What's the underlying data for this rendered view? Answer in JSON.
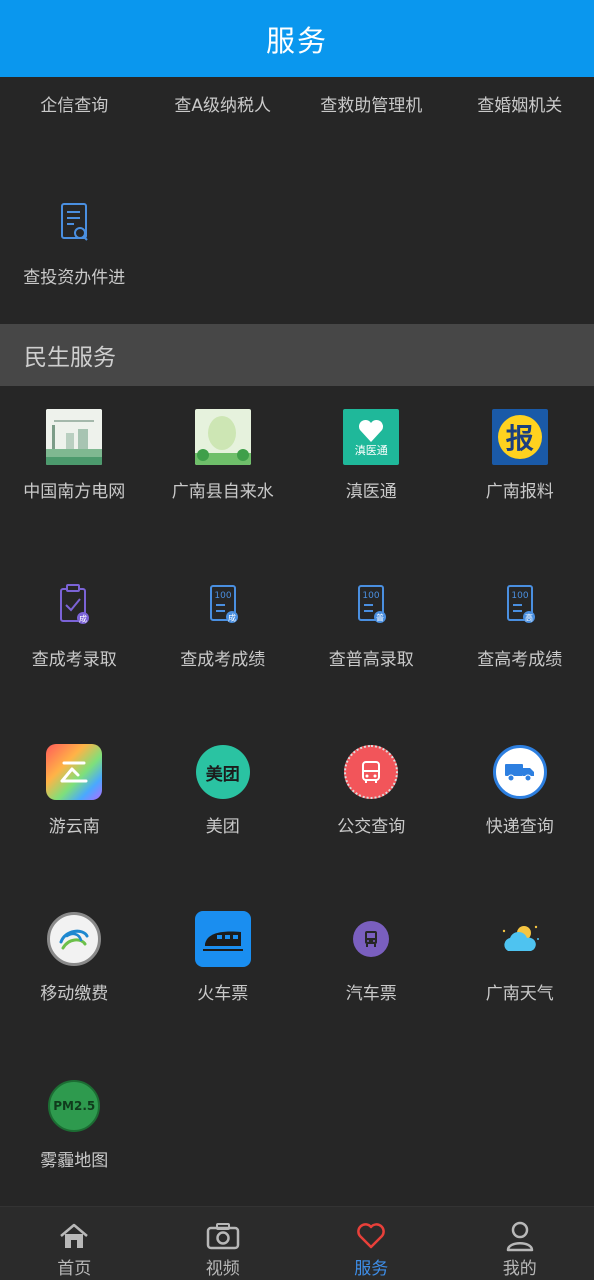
{
  "header": {
    "title": "服务"
  },
  "top_row": [
    "企信查询",
    "查A级纳税人",
    "查救助管理机",
    "查婚姻机关"
  ],
  "top_items": [
    {
      "label": "查投资办件进",
      "icon": "document-search-icon"
    }
  ],
  "section": {
    "title": "民生服务"
  },
  "services": [
    {
      "label": "中国南方电网",
      "icon": "power-grid-thumbnail"
    },
    {
      "label": "广南县自来水",
      "icon": "water-utility-thumbnail"
    },
    {
      "label": "滇医通",
      "icon": "dianyitong-logo-icon"
    },
    {
      "label": "广南报料",
      "icon": "bao-report-icon"
    },
    {
      "label": "查成考录取",
      "icon": "clipboard-check-icon"
    },
    {
      "label": "查成考成绩",
      "icon": "score-report-icon"
    },
    {
      "label": "查普高录取",
      "icon": "score-report-icon"
    },
    {
      "label": "查高考成绩",
      "icon": "score-report-icon"
    },
    {
      "label": "游云南",
      "icon": "you-yunnan-logo-icon"
    },
    {
      "label": "美团",
      "icon": "meituan-logo-icon"
    },
    {
      "label": "公交查询",
      "icon": "bus-query-icon"
    },
    {
      "label": "快递查询",
      "icon": "delivery-truck-icon"
    },
    {
      "label": "移动缴费",
      "icon": "china-mobile-icon"
    },
    {
      "label": "火车票",
      "icon": "train-icon"
    },
    {
      "label": "汽车票",
      "icon": "bus-ticket-icon"
    },
    {
      "label": "广南天气",
      "icon": "weather-icon"
    },
    {
      "label": "雾霾地图",
      "icon": "pm25-icon"
    }
  ],
  "icon_texts": {
    "dianyitong": "滇医通",
    "bao": "报",
    "meituan": "美团",
    "score": "100",
    "badge_cheng": "成",
    "badge_pu": "普",
    "badge_gao": "高",
    "pm": "PM2.5"
  },
  "tabbar": [
    {
      "label": "首页",
      "icon": "home-icon",
      "active": false
    },
    {
      "label": "视频",
      "icon": "camera-icon",
      "active": false
    },
    {
      "label": "服务",
      "icon": "heart-icon",
      "active": true
    },
    {
      "label": "我的",
      "icon": "user-icon",
      "active": false
    }
  ],
  "colors": {
    "header": "#0a97ee",
    "active_tab": "#3e8ee8",
    "background": "#262626",
    "section": "#474747"
  }
}
